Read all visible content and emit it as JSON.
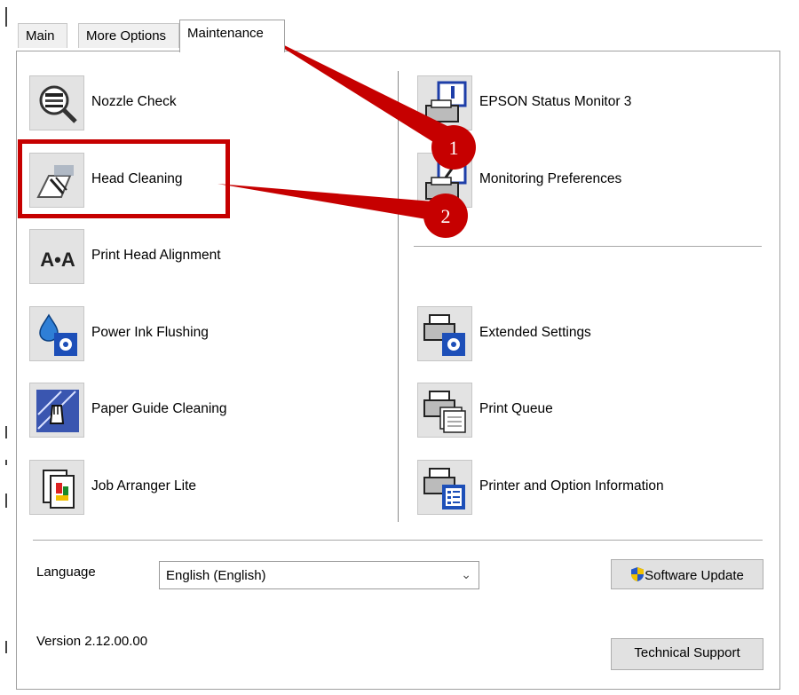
{
  "tabs": [
    {
      "label": "Main",
      "active": false
    },
    {
      "label": "More Options",
      "active": false
    },
    {
      "label": "Maintenance",
      "active": true
    }
  ],
  "left_tools": [
    {
      "label": "Nozzle Check",
      "icon": "nozzle-check-icon"
    },
    {
      "label": "Head Cleaning",
      "icon": "head-cleaning-icon"
    },
    {
      "label": "Print Head Alignment",
      "icon": "alignment-icon"
    },
    {
      "label": "Power Ink Flushing",
      "icon": "ink-flushing-icon"
    },
    {
      "label": "Paper Guide Cleaning",
      "icon": "paper-guide-cleaning-icon"
    },
    {
      "label": "Job Arranger Lite",
      "icon": "job-arranger-icon"
    }
  ],
  "right_tools": [
    {
      "label": "EPSON Status Monitor 3",
      "icon": "status-monitor-icon"
    },
    {
      "label": "Monitoring Preferences",
      "icon": "monitoring-preferences-icon"
    },
    {
      "label": "Extended Settings",
      "icon": "extended-settings-icon"
    },
    {
      "label": "Print Queue",
      "icon": "print-queue-icon"
    },
    {
      "label": "Printer and Option Information",
      "icon": "printer-info-icon"
    }
  ],
  "alignment_icon_text": "A•A",
  "language": {
    "label": "Language",
    "value": "English (English)"
  },
  "buttons": {
    "software_update": "Software Update",
    "technical_support": "Technical Support"
  },
  "version": "Version 2.12.00.00",
  "annotations": {
    "marker1": "1",
    "marker2": "2",
    "color": "#c60000"
  }
}
